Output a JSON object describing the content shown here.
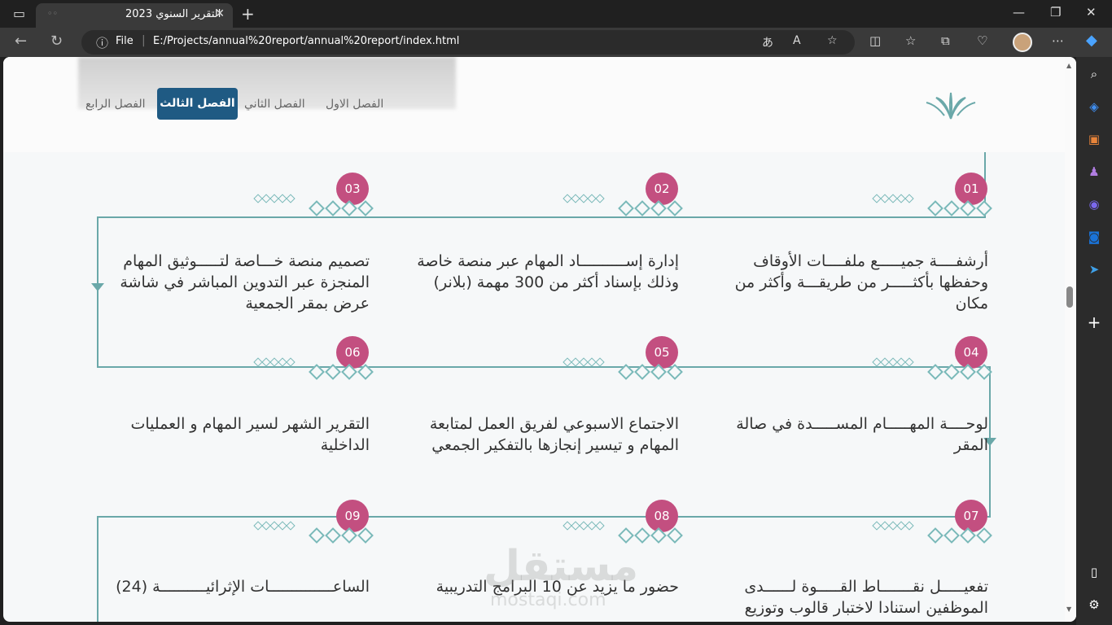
{
  "browser": {
    "tab_title": "التقرير السنوي 2023",
    "address_label": "File",
    "url": "E:/Projects/annual%20report/annual%20report/index.html"
  },
  "nav": {
    "items": [
      "الفصل الاول",
      "الفصل الثاني",
      "الفصل الثالث",
      "الفصل الرابع"
    ],
    "active": "الفصل الثالث"
  },
  "timeline": [
    {
      "num": "01",
      "text": "أرشفــــة جميـــــع ملفــــات الأوقاف وحفظها بأكثـــــر من طريقـــة وأكثر من مكان"
    },
    {
      "num": "02",
      "text": "إدارة إســــــــــاد المهام عبر منصة خاصة وذلك بإسناد أكثر من 300 مهمة (بلانر)"
    },
    {
      "num": "03",
      "text": "تصميم منصة خـــاصة لتـــــوثيق المهام المنجزة عبر التدوين المباشر في شاشة عرض بمقر الجمعية"
    },
    {
      "num": "04",
      "text": "لوحــــة المهـــــام المســـــدة في صالة المقر"
    },
    {
      "num": "05",
      "text": "الاجتماع الاسبوعي لفريق العمل لمتابعة المهام و تيسير إنجازها بالتفكير الجمعي"
    },
    {
      "num": "06",
      "text": "التقرير الشهر لسير المهام و العمليات الداخلية"
    },
    {
      "num": "07",
      "text": "تفعيـــــل نقـــــــاط القـــــوة لــــــدى الموظفين استنادا لاختبار قالوب وتوزيع"
    },
    {
      "num": "08",
      "text": "حضور ما يزيد عن 10 البرامج التدريبية"
    },
    {
      "num": "09",
      "text": "الساعــــــــــــــات الإثرائيــــــــــة (24)"
    }
  ],
  "watermark": {
    "ar": "مستقل",
    "en": "mostaqi.com"
  },
  "colors": {
    "accent": "#1f5a83",
    "circle": "#c34f80",
    "line": "#6aa8a9"
  }
}
